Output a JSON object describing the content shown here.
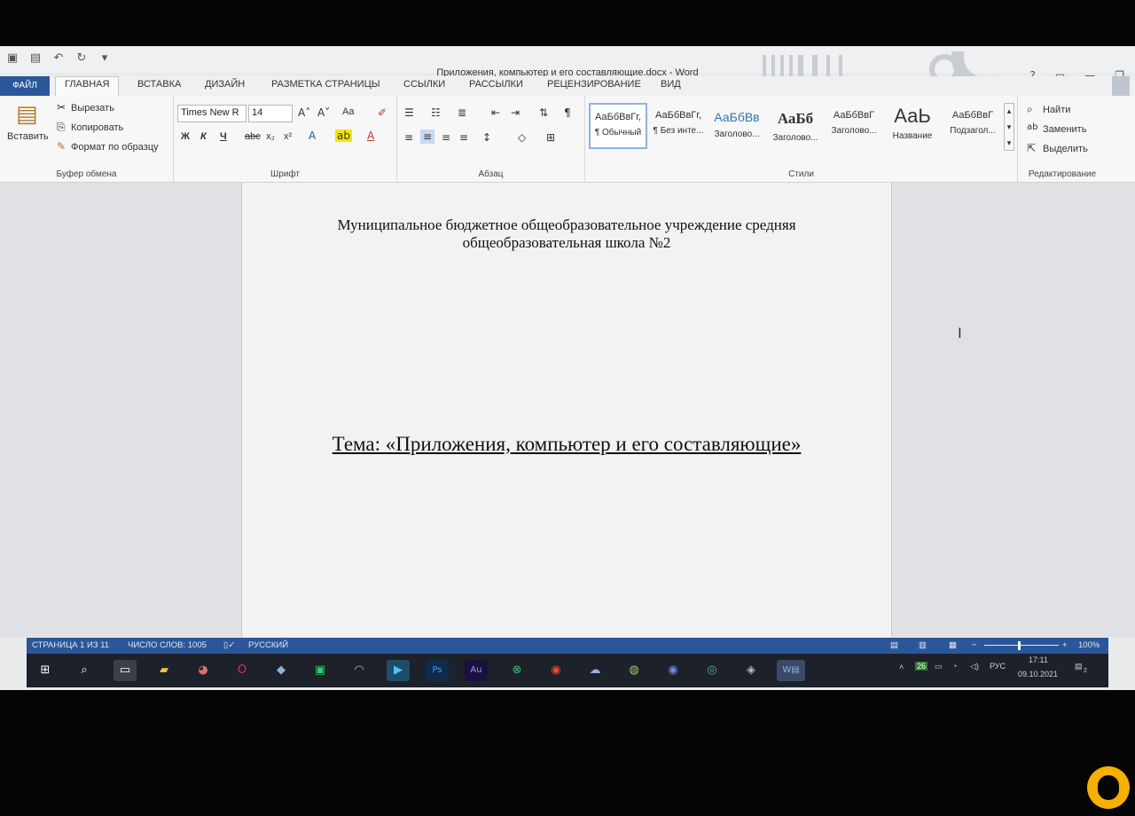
{
  "window": {
    "title": "Приложения, компьютер и его составляющие.docx - Word",
    "help": "?"
  },
  "tabs": [
    "ФАЙЛ",
    "ГЛАВНАЯ",
    "ВСТАВКА",
    "ДИЗАЙН",
    "РАЗМЕТКА СТРАНИЦЫ",
    "ССЫЛКИ",
    "РАССЫЛКИ",
    "РЕЦЕНЗИРОВАНИЕ",
    "ВИД"
  ],
  "active_tab": "ГЛАВНАЯ",
  "clipboard": {
    "paste": "Вставить",
    "cut": "Вырезать",
    "copy": "Копировать",
    "format_painter": "Формат по образцу",
    "label": "Буфер обмена"
  },
  "font": {
    "name": "Times New R",
    "size": "14",
    "bold": "Ж",
    "italic": "К",
    "underline": "Ч",
    "strike": "abc",
    "sub": "x₂",
    "sup": "x²",
    "case": "Aa",
    "label": "Шрифт"
  },
  "paragraph": {
    "label": "Абзац"
  },
  "styles": {
    "label": "Стили",
    "items": [
      {
        "sample": "АаБбВвГг,",
        "name": "¶ Обычный"
      },
      {
        "sample": "АаБбВвГг,",
        "name": "¶ Без инте..."
      },
      {
        "sample": "АаБбВв",
        "name": "Заголово..."
      },
      {
        "sample": "АаБб",
        "name": "Заголово..."
      },
      {
        "sample": "АаБбВвГ",
        "name": "Заголово..."
      },
      {
        "sample": "АаЬ",
        "name": "Название"
      },
      {
        "sample": "АаБбВвГ",
        "name": "Подзагол..."
      }
    ]
  },
  "editing": {
    "find": "Найти",
    "replace": "Заменить",
    "select": "Выделить",
    "label": "Редактирование"
  },
  "document": {
    "header_line1": "Муниципальное бюджетное общеобразовательное учреждение средняя",
    "header_line2": "общеобразовательная школа №2",
    "topic": "Тема: «Приложения, компьютер и его составляющие»"
  },
  "status": {
    "page": "СТРАНИЦА 1 ИЗ 11",
    "words": "ЧИСЛО СЛОВ: 1005",
    "language": "РУССКИЙ",
    "zoom": "100%"
  },
  "taskbar": {
    "tray_weather": "26",
    "lang": "РУС",
    "time": "17:11",
    "date": "09.10.2021",
    "notif": "2"
  }
}
